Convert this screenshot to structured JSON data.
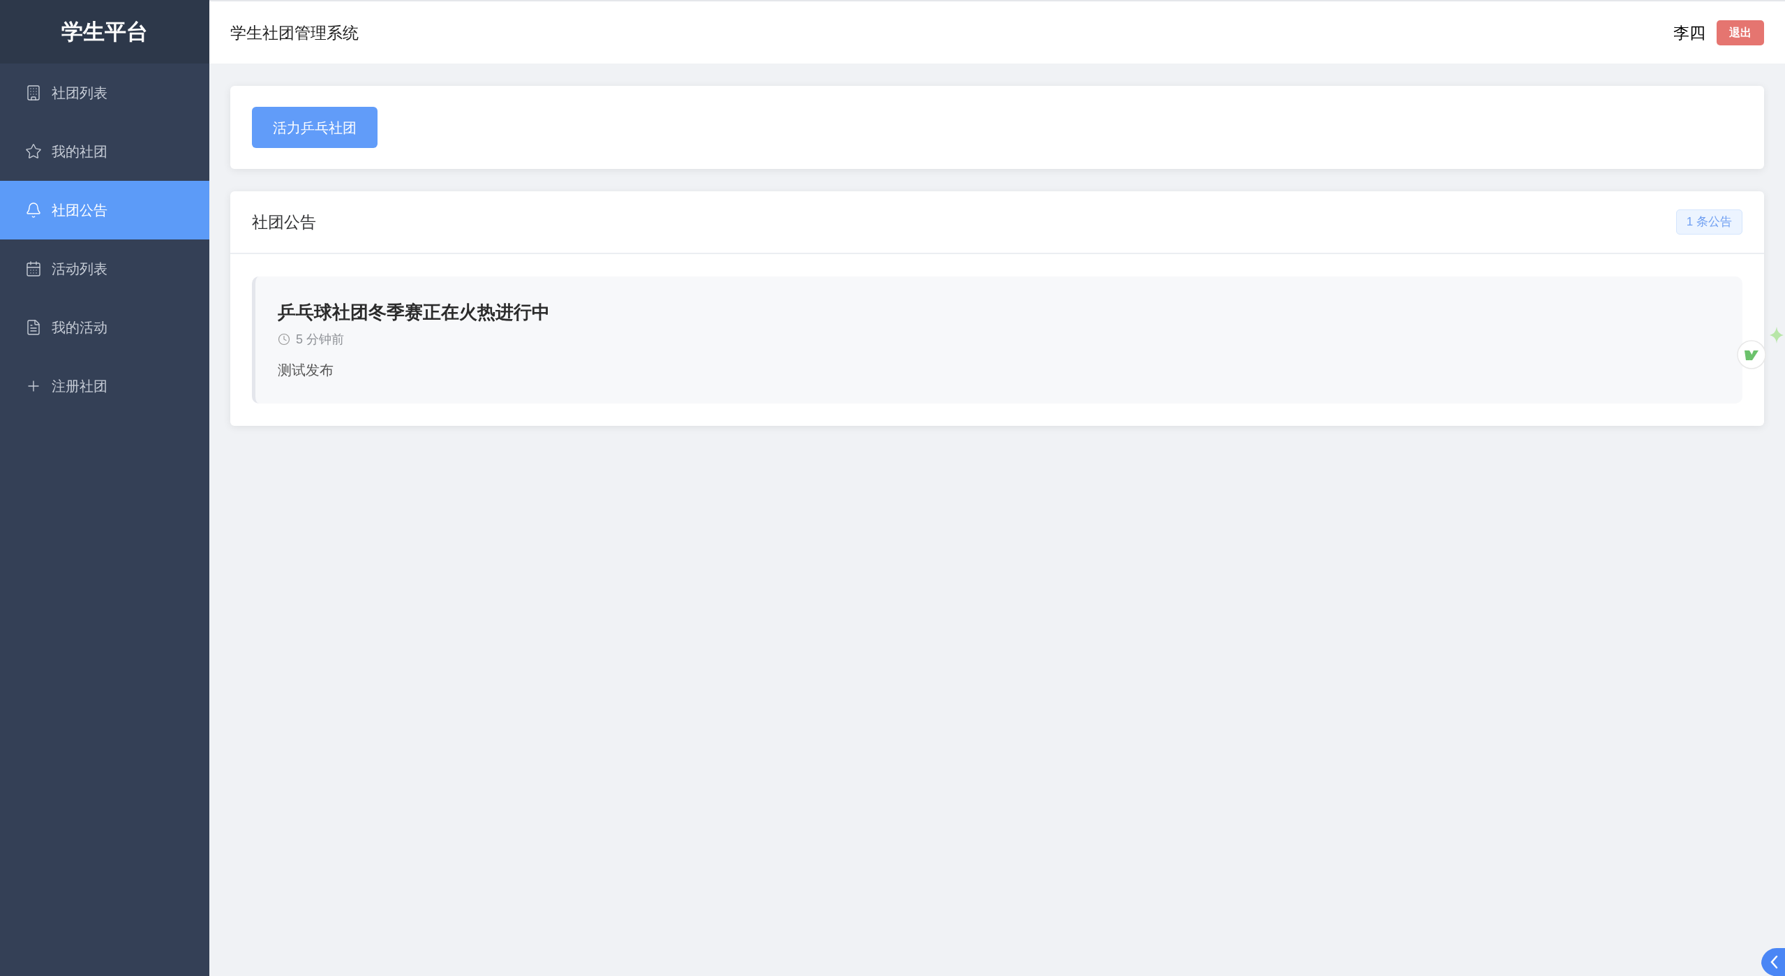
{
  "sidebar": {
    "title": "学生平台",
    "items": [
      {
        "label": "社团列表",
        "selected": false
      },
      {
        "label": "我的社团",
        "selected": false
      },
      {
        "label": "社团公告",
        "selected": true
      },
      {
        "label": "活动列表",
        "selected": false
      },
      {
        "label": "我的活动",
        "selected": false
      },
      {
        "label": "注册社团",
        "selected": false
      }
    ]
  },
  "header": {
    "title": "学生社团管理系统",
    "user": "李四",
    "logout": "退出"
  },
  "clubs": [
    {
      "label": "活力乒乓社团",
      "selected": true
    }
  ],
  "notices": {
    "title": "社团公告",
    "count": "1 条公告",
    "items": [
      {
        "title": "乒乓球社团冬季赛正在火热进行中",
        "time": "5 分钟前",
        "content": "测试发布"
      }
    ]
  }
}
